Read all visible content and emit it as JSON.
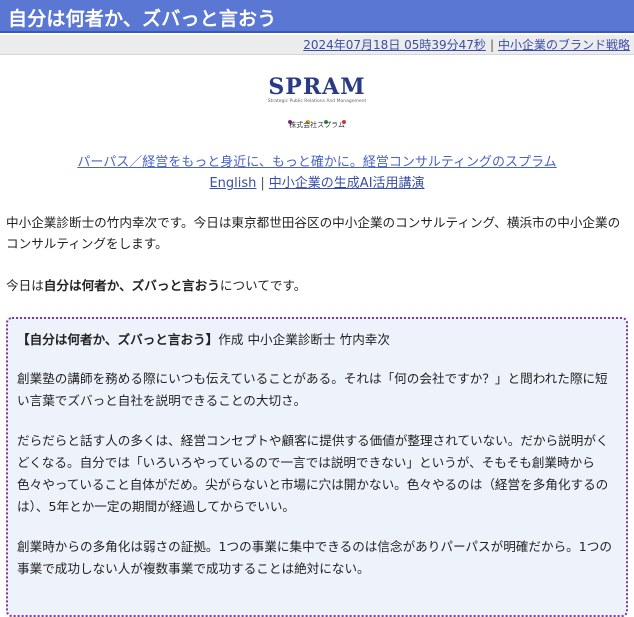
{
  "page": {
    "title": "自分は何者か、ズバっと言おう"
  },
  "meta": {
    "timestamp": "2024年07月18日 05時39分47秒",
    "separator": "|",
    "category": "中小企業のブランド戦略"
  },
  "logo": {
    "wordmark": "SPRAM",
    "tagline": "Strategic Public Relations And Management",
    "company": "株式会社スプラム",
    "dot_colors": [
      "#8a2a8a",
      "#d8a21c",
      "#2e8b3a",
      "#c83c3c"
    ]
  },
  "links": {
    "tagline": "パーパス／経営をもっと身近に、もっと確かに。経営コンサルティングのスプラム",
    "english": "English",
    "separator": "|",
    "ai_course": "中小企業の生成AI活用講演"
  },
  "intro": {
    "text": "中小企業診断士の竹内幸次です。今日は東京都世田谷区の中小企業のコンサルティング、横浜市の中小企業のコンサルティングをします。"
  },
  "today": {
    "prefix": "今日は",
    "topic": "自分は何者か、ズバっと言おう",
    "suffix": "についてです。"
  },
  "article": {
    "heading_bold": "【自分は何者か、ズバっと言おう】",
    "heading_rest": "作成 中小企業診断士 竹内幸次",
    "paragraphs": [
      "創業塾の講師を務める際にいつも伝えていることがある。それは「何の会社ですか？」と問われた際に短い言葉でズバっと自社を説明できることの大切さ。",
      "だらだらと話す人の多くは、経営コンセプトや顧客に提供する価値が整理されていない。だから説明がくどくなる。自分では「いろいろやっているので一言では説明できない」というが、そもそも創業時から色々やっていること自体がだめ。尖がらないと市場に穴は開かない。色々やるのは（経営を多角化するのは）、5年とか一定の期間が経過してからでいい。",
      "創業時からの多角化は弱さの証拠。1つの事業に集中できるのは信念がありパーパスが明確だから。1つの事業で成功しない人が複数事業で成功することは絶対にない。"
    ]
  }
}
